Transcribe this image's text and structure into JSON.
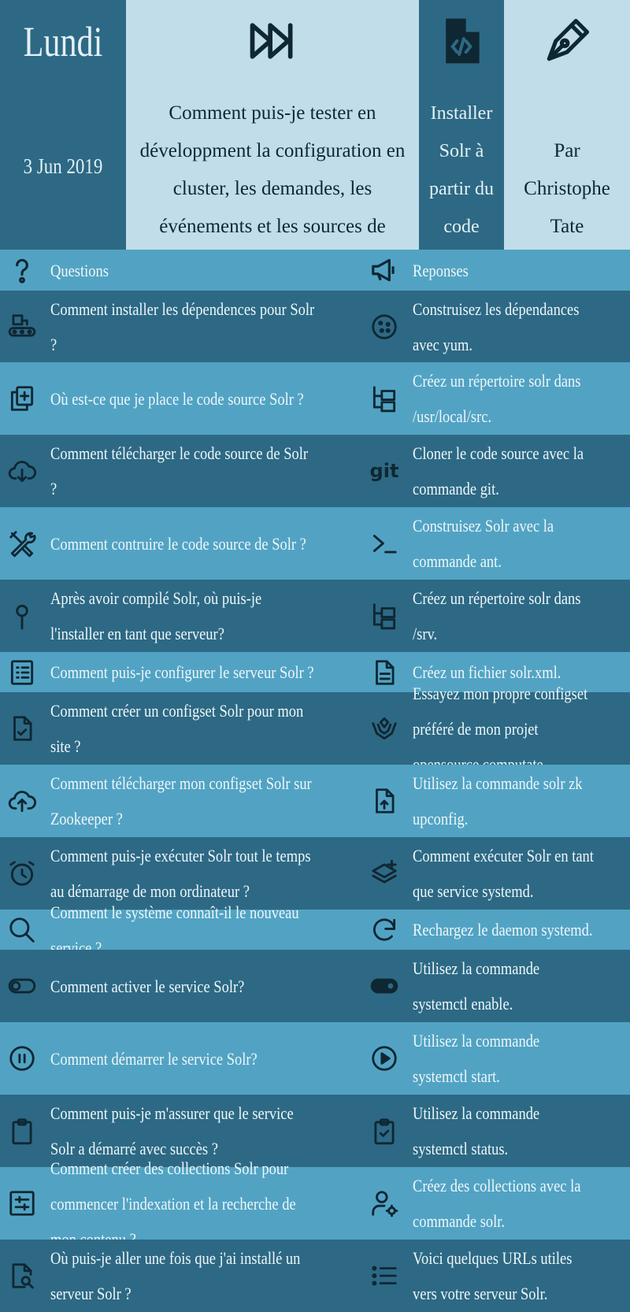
{
  "header": {
    "day": "Lundi",
    "date": "3 Jun 2019",
    "question": "Comment puis-je tester en développment la configuration en cluster, les demandes, les événements et les sources de données partagées ?",
    "install": "Installer Solr à partir du code source.",
    "author": "Par Christophe Tate",
    "icons": [
      "fast-forward-icon",
      "code-file-icon",
      "pen-nib-icon"
    ]
  },
  "columns": {
    "questions": "Questions",
    "responses": "Reponses",
    "questions_icon": "question-mark-icon",
    "responses_icon": "megaphone-icon"
  },
  "rows": [
    {
      "q_icon": "conveyor-belt-icon",
      "question": "Comment installer les dépendences pour Solr ?",
      "r_icon": "cookie-icon",
      "response": "Construisez les dépendances avec yum."
    },
    {
      "q_icon": "copy-plus-icon",
      "question": "Où est-ce que je place le code source Solr ?",
      "r_icon": "folder-tree-icon",
      "response": "Créez un répertoire solr dans /usr/local/src."
    },
    {
      "q_icon": "cloud-download-icon",
      "question": "Comment télécharger le code source de Solr ?",
      "r_icon": "git-icon",
      "response": "Cloner le code source avec la commande git."
    },
    {
      "q_icon": "tools-icon",
      "question": "Comment contruire le code source de Solr ?",
      "r_icon": "terminal-prompt-icon",
      "response": "Construisez Solr avec la commande ant."
    },
    {
      "q_icon": "map-pin-icon",
      "question": "Après avoir compilé Solr, où puis-je l'installer en tant que serveur?",
      "r_icon": "folder-tree-icon",
      "response": "Créez un répertoire solr dans /srv."
    },
    {
      "q_icon": "list-checklist-icon",
      "question": "Comment puis-je configurer le serveur Solr ?",
      "r_icon": "document-icon",
      "response": "Créez un fichier solr.xml."
    },
    {
      "q_icon": "file-check-icon",
      "question": "Comment créer un configset Solr pour mon site ?",
      "r_icon": "heart-hands-icon",
      "response": "Essayez mon propre configset préféré de mon projet opensource computate."
    },
    {
      "q_icon": "cloud-upload-icon",
      "question": "Comment télécharger mon configset Solr sur Zookeeper ?",
      "r_icon": "file-upload-icon",
      "response": "Utilisez la commande solr zk upconfig."
    },
    {
      "q_icon": "alarm-clock-icon",
      "question": "Comment puis-je exécuter Solr tout le temps au démarrage de mon ordinateur ?",
      "r_icon": "layers-plus-icon",
      "response": "Comment exécuter Solr en tant que service systemd."
    },
    {
      "q_icon": "search-icon",
      "question": "Comment le système connaît-il le nouveau service ?",
      "r_icon": "reload-icon",
      "response": "Rechargez le daemon systemd."
    },
    {
      "q_icon": "toggle-off-icon",
      "question": "Comment activer le service Solr?",
      "r_icon": "toggle-on-icon",
      "response": "Utilisez la commande systemctl enable."
    },
    {
      "q_icon": "pause-circle-icon",
      "question": "Comment démarrer le service Solr?",
      "r_icon": "play-circle-icon",
      "response": "Utilisez la commande systemctl start."
    },
    {
      "q_icon": "clipboard-icon",
      "question": "Comment puis-je m'assurer que le service Solr a démarré avec succès ?",
      "r_icon": "clipboard-check-icon",
      "response": "Utilisez la commande systemctl status."
    },
    {
      "q_icon": "adjustments-icon",
      "question": "Comment créer des collections Solr pour commencer l'indexation et la recherche de mon contenu ?",
      "r_icon": "user-settings-icon",
      "response": "Créez des collections avec la commande solr."
    },
    {
      "q_icon": "file-search-icon",
      "question": "Où puis-je aller une fois que j'ai installé un serveur Solr ?",
      "r_icon": "list-icon",
      "response": "Voici quelques URLs utiles vers votre serveur Solr."
    }
  ],
  "colors": {
    "dark": "#2d6984",
    "light": "#52a3c3",
    "pale": "#c0dde9",
    "ink": "#0f2733"
  }
}
